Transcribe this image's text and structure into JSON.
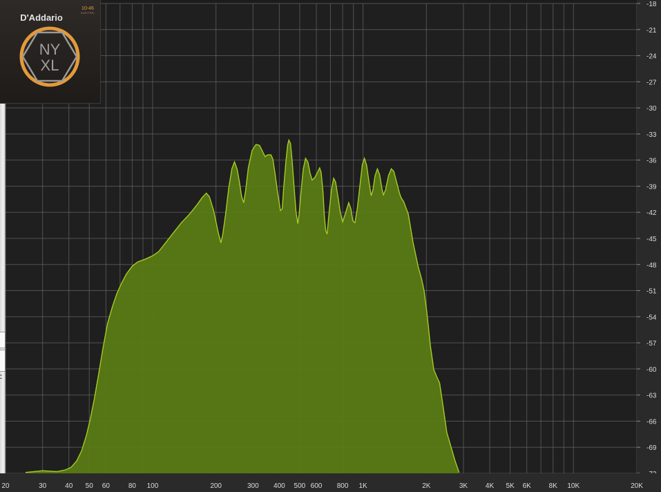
{
  "window": {
    "badge_brand": "D'Addario",
    "badge_gauge": "10-46",
    "badge_subtitle": "ELECTRIC",
    "badge_line1": "NY",
    "badge_line2": "XL",
    "edge_letter": "c"
  },
  "colors": {
    "background": "#1c1c1c",
    "plot_background": "#1f1f1f",
    "grid": "#5e5e5e",
    "fill": "#5a7a14",
    "stroke": "#a6cc27",
    "tick_text": "#dddddd",
    "badge_orange": "#e39a3b"
  },
  "chart_data": {
    "type": "area",
    "title": "",
    "xlabel": "",
    "ylabel": "",
    "xscale": "log",
    "xlim": [
      20,
      20000
    ],
    "ylim": [
      -72,
      -18
    ],
    "grid": true,
    "x_ticks": [
      {
        "value": 20,
        "label": "20"
      },
      {
        "value": 30,
        "label": "30"
      },
      {
        "value": 40,
        "label": "40"
      },
      {
        "value": 50,
        "label": "50"
      },
      {
        "value": 60,
        "label": "60"
      },
      {
        "value": 80,
        "label": "80"
      },
      {
        "value": 100,
        "label": "100"
      },
      {
        "value": 200,
        "label": "200"
      },
      {
        "value": 300,
        "label": "300"
      },
      {
        "value": 400,
        "label": "400"
      },
      {
        "value": 500,
        "label": "500"
      },
      {
        "value": 600,
        "label": "600"
      },
      {
        "value": 800,
        "label": "800"
      },
      {
        "value": 1000,
        "label": "1K"
      },
      {
        "value": 2000,
        "label": "2K"
      },
      {
        "value": 3000,
        "label": "3K"
      },
      {
        "value": 4000,
        "label": "4K"
      },
      {
        "value": 5000,
        "label": "5K"
      },
      {
        "value": 6000,
        "label": "6K"
      },
      {
        "value": 8000,
        "label": "8K"
      },
      {
        "value": 10000,
        "label": "10K"
      },
      {
        "value": 20000,
        "label": "20K"
      }
    ],
    "y_ticks": [
      -18,
      -21,
      -24,
      -27,
      -30,
      -33,
      -36,
      -39,
      -42,
      -45,
      -48,
      -51,
      -54,
      -57,
      -60,
      -63,
      -66,
      -69,
      -72
    ],
    "series": [
      {
        "name": "",
        "points": [
          [
            24.9,
            -71.9
          ],
          [
            30,
            -71.7
          ],
          [
            35,
            -71.8
          ],
          [
            38.5,
            -71.6
          ],
          [
            41,
            -71.3
          ],
          [
            43.5,
            -70.6
          ],
          [
            46,
            -69.4
          ],
          [
            48.5,
            -67.6
          ],
          [
            50.5,
            -65.8
          ],
          [
            52.8,
            -63.5
          ],
          [
            55.5,
            -60.5
          ],
          [
            58,
            -57.7
          ],
          [
            61,
            -54.8
          ],
          [
            64.5,
            -52.8
          ],
          [
            67.5,
            -51.4
          ],
          [
            71,
            -50.2
          ],
          [
            75,
            -49.1
          ],
          [
            80,
            -48.2
          ],
          [
            85,
            -47.7
          ],
          [
            92,
            -47.4
          ],
          [
            100,
            -47.0
          ],
          [
            107,
            -46.5
          ],
          [
            117,
            -45.3
          ],
          [
            127,
            -44.2
          ],
          [
            137,
            -43.2
          ],
          [
            150,
            -42.2
          ],
          [
            163,
            -41.1
          ],
          [
            172,
            -40.3
          ],
          [
            180,
            -39.8
          ],
          [
            186,
            -40.2
          ],
          [
            195,
            -41.8
          ],
          [
            205,
            -44.3
          ],
          [
            211,
            -45.5
          ],
          [
            215,
            -44.7
          ],
          [
            222,
            -42.3
          ],
          [
            230,
            -39.2
          ],
          [
            238,
            -37.0
          ],
          [
            245,
            -36.2
          ],
          [
            252,
            -37.0
          ],
          [
            258,
            -38.4
          ],
          [
            265,
            -40.2
          ],
          [
            271,
            -40.9
          ],
          [
            277,
            -39.4
          ],
          [
            285,
            -36.9
          ],
          [
            297,
            -34.9
          ],
          [
            310,
            -34.2
          ],
          [
            322,
            -34.3
          ],
          [
            333,
            -35.0
          ],
          [
            342,
            -35.6
          ],
          [
            352,
            -35.4
          ],
          [
            365,
            -35.4
          ],
          [
            373,
            -35.9
          ],
          [
            382,
            -37.6
          ],
          [
            392,
            -39.6
          ],
          [
            405,
            -41.8
          ],
          [
            413,
            -41.6
          ],
          [
            420,
            -39.1
          ],
          [
            430,
            -36.2
          ],
          [
            438,
            -34.3
          ],
          [
            444,
            -33.7
          ],
          [
            452,
            -34.1
          ],
          [
            460,
            -36.0
          ],
          [
            470,
            -39.0
          ],
          [
            480,
            -41.9
          ],
          [
            490,
            -43.3
          ],
          [
            497,
            -42.2
          ],
          [
            508,
            -39.5
          ],
          [
            520,
            -37.0
          ],
          [
            533,
            -35.8
          ],
          [
            548,
            -36.3
          ],
          [
            560,
            -37.5
          ],
          [
            573,
            -38.3
          ],
          [
            590,
            -38.0
          ],
          [
            608,
            -37.4
          ],
          [
            622,
            -36.9
          ],
          [
            632,
            -37.4
          ],
          [
            645,
            -39.6
          ],
          [
            655,
            -42.4
          ],
          [
            665,
            -44.1
          ],
          [
            675,
            -44.5
          ],
          [
            690,
            -42.0
          ],
          [
            708,
            -39.4
          ],
          [
            725,
            -38.1
          ],
          [
            740,
            -38.5
          ],
          [
            760,
            -40.2
          ],
          [
            780,
            -42.0
          ],
          [
            800,
            -43.1
          ],
          [
            825,
            -42.1
          ],
          [
            855,
            -40.9
          ],
          [
            875,
            -41.6
          ],
          [
            895,
            -43.0
          ],
          [
            915,
            -43.2
          ],
          [
            940,
            -41.5
          ],
          [
            968,
            -38.8
          ],
          [
            992,
            -36.5
          ],
          [
            1015,
            -35.8
          ],
          [
            1040,
            -36.6
          ],
          [
            1070,
            -38.7
          ],
          [
            1093,
            -40.1
          ],
          [
            1115,
            -39.4
          ],
          [
            1140,
            -37.8
          ],
          [
            1170,
            -37.0
          ],
          [
            1200,
            -37.7
          ],
          [
            1228,
            -39.2
          ],
          [
            1250,
            -40.0
          ],
          [
            1280,
            -39.4
          ],
          [
            1320,
            -37.8
          ],
          [
            1362,
            -37.0
          ],
          [
            1400,
            -37.3
          ],
          [
            1450,
            -38.7
          ],
          [
            1490,
            -39.8
          ],
          [
            1515,
            -40.3
          ],
          [
            1560,
            -40.8
          ],
          [
            1640,
            -42.2
          ],
          [
            1730,
            -45.5
          ],
          [
            1830,
            -48.3
          ],
          [
            1900,
            -49.7
          ],
          [
            1950,
            -51.0
          ],
          [
            2010,
            -53.5
          ],
          [
            2090,
            -57.4
          ],
          [
            2170,
            -60.1
          ],
          [
            2250,
            -61.0
          ],
          [
            2310,
            -61.6
          ],
          [
            2400,
            -64.3
          ],
          [
            2500,
            -67.3
          ],
          [
            2620,
            -69.0
          ],
          [
            2740,
            -70.6
          ],
          [
            2860,
            -71.9
          ]
        ]
      }
    ]
  }
}
